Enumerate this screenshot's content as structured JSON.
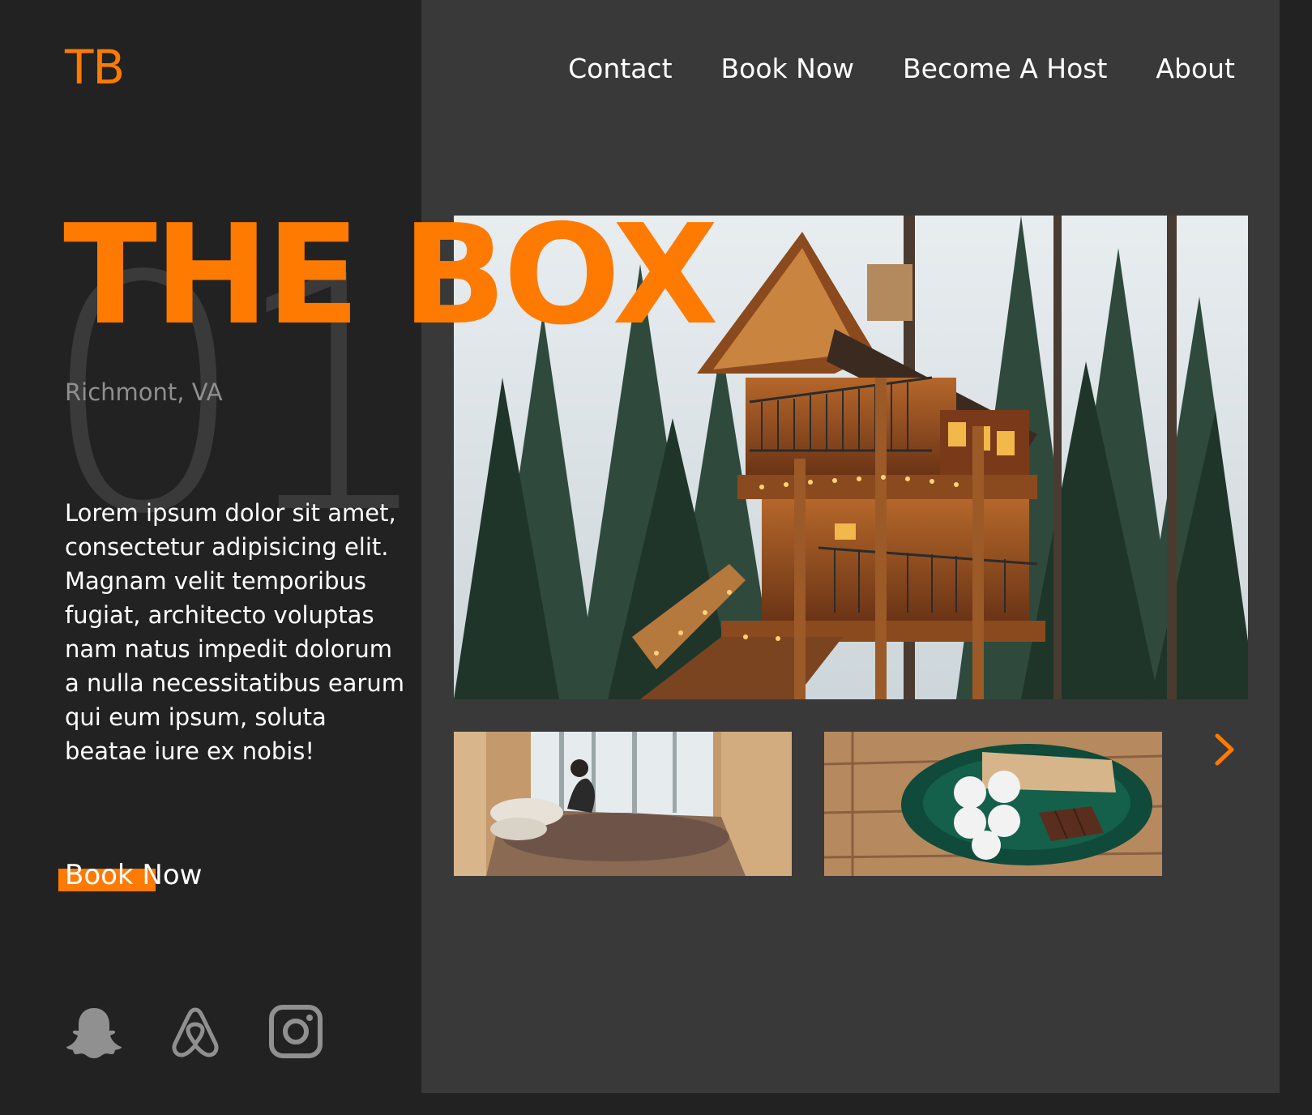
{
  "logo": {
    "text": "TB"
  },
  "nav": [
    {
      "label": "Contact"
    },
    {
      "label": "Book Now"
    },
    {
      "label": "Become A Host"
    },
    {
      "label": "About"
    }
  ],
  "hero": {
    "number": "01",
    "title": "THE BOX",
    "location": "Richmont, VA",
    "description": "Lorem ipsum dolor sit amet, consectetur adipisicing elit. Magnam velit temporibus fugiat, architecto voluptas nam natus impedit dolorum a nulla necessitatibus earum qui eum ipsum, soluta beatae iure ex nobis!",
    "cta": "Book Now"
  },
  "social": [
    "snapchat-icon",
    "airbnb-icon",
    "instagram-icon"
  ],
  "colors": {
    "accent": "#ff7a00",
    "left_bg": "#222222",
    "right_bg": "#393939",
    "muted_text": "#8f8f8f"
  },
  "images": {
    "hero": "treehouse in snowy pine forest",
    "thumbnails": [
      "cabin bedroom window snow",
      "plate of smores ingredients"
    ]
  }
}
